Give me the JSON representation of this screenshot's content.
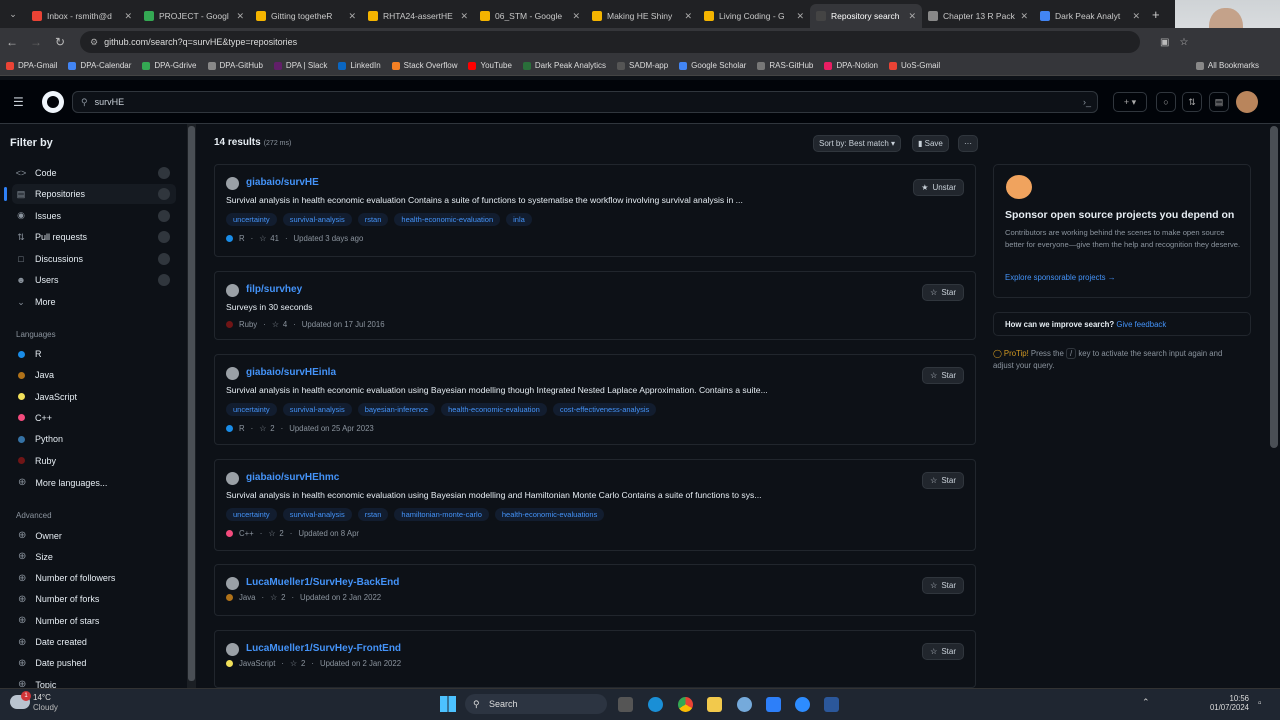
{
  "browser": {
    "tabs": [
      {
        "label": "Inbox - rsmith@d",
        "color": "#ea4335"
      },
      {
        "label": "PROJECT - Googl",
        "color": "#34a853"
      },
      {
        "label": "Gitting togetheR",
        "color": "#f4b400"
      },
      {
        "label": "RHTA24-assertHE",
        "color": "#f4b400"
      },
      {
        "label": "06_STM - Google",
        "color": "#f4b400"
      },
      {
        "label": "Making HE Shiny",
        "color": "#f4b400"
      },
      {
        "label": "Living Coding - G",
        "color": "#f4b400"
      },
      {
        "label": "Repository search",
        "color": "#444444"
      },
      {
        "label": "Chapter 13 R Pack",
        "color": "#888888"
      },
      {
        "label": "Dark Peak Analyt",
        "color": "#4285f4"
      }
    ],
    "url": "github.com/search?q=survHE&type=repositories",
    "bookmarks": [
      "DPA-Gmail",
      "DPA-Calendar",
      "DPA-Gdrive",
      "DPA-GitHub",
      "DPA | Slack",
      "LinkedIn",
      "Stack Overflow",
      "YouTube",
      "Dark Peak Analytics",
      "SADM-app",
      "Google Scholar",
      "RAS-GitHub",
      "DPA-Notion",
      "UoS-Gmail"
    ],
    "all_bookmarks": "All Bookmarks"
  },
  "github": {
    "search_query": "survHE"
  },
  "sidebar": {
    "title": "Filter by",
    "types": [
      {
        "label": "Code",
        "icon": "code-icon"
      },
      {
        "label": "Repositories",
        "icon": "repo-icon",
        "selected": true
      },
      {
        "label": "Issues",
        "icon": "issue-icon"
      },
      {
        "label": "Pull requests",
        "icon": "pull-request-icon"
      },
      {
        "label": "Discussions",
        "icon": "discussion-icon"
      },
      {
        "label": "Users",
        "icon": "people-icon"
      }
    ],
    "more": "More",
    "languages_label": "Languages",
    "languages": [
      {
        "name": "R",
        "color": "#198ce7"
      },
      {
        "name": "Java",
        "color": "#b07219"
      },
      {
        "name": "JavaScript",
        "color": "#f1e05a"
      },
      {
        "name": "C++",
        "color": "#f34b7d"
      },
      {
        "name": "Python",
        "color": "#3572a5"
      },
      {
        "name": "Ruby",
        "color": "#701516"
      }
    ],
    "more_languages": "More languages...",
    "advanced_label": "Advanced",
    "advanced": [
      "Owner",
      "Size",
      "Number of followers",
      "Number of forks",
      "Number of stars",
      "Date created",
      "Date pushed",
      "Topic"
    ]
  },
  "results": {
    "count": "14 results",
    "time": "(272 ms)",
    "sort": "Sort by: Best match",
    "save": "Save",
    "items": [
      {
        "name": "giabaio/survHE",
        "desc": "Survival analysis in health economic evaluation Contains a suite of functions to systematise the workflow involving survival analysis in ...",
        "topics": [
          "uncertainty",
          "survival-analysis",
          "rstan",
          "health-economic-evaluation",
          "inla"
        ],
        "lang": "R",
        "lang_color": "#198ce7",
        "stars": "41",
        "updated": "Updated 3 days ago",
        "star_label": "Unstar"
      },
      {
        "name": "filp/survhey",
        "desc": "Surveys in 30 seconds",
        "topics": [],
        "lang": "Ruby",
        "lang_color": "#701516",
        "stars": "4",
        "updated": "Updated on 17 Jul 2016",
        "star_label": "Star"
      },
      {
        "name": "giabaio/survHEinla",
        "desc": "Survival analysis in health economic evaluation using Bayesian modelling though Integrated Nested Laplace Approximation. Contains a suite...",
        "topics": [
          "uncertainty",
          "survival-analysis",
          "bayesian-inference",
          "health-economic-evaluation",
          "cost-effectiveness-analysis"
        ],
        "lang": "R",
        "lang_color": "#198ce7",
        "stars": "2",
        "updated": "Updated on 25 Apr 2023",
        "star_label": "Star"
      },
      {
        "name": "giabaio/survHEhmc",
        "desc": "Survival analysis in health economic evaluation using Bayesian modelling and Hamiltonian Monte Carlo Contains a suite of functions to sys...",
        "topics": [
          "uncertainty",
          "survival-analysis",
          "rstan",
          "hamiltonian-monte-carlo",
          "health-economic-evaluations"
        ],
        "lang": "C++",
        "lang_color": "#f34b7d",
        "stars": "2",
        "updated": "Updated on 8 Apr",
        "star_label": "Star"
      },
      {
        "name": "LucaMueller1/SurvHey-BackEnd",
        "desc": "",
        "topics": [],
        "lang": "Java",
        "lang_color": "#b07219",
        "stars": "2",
        "updated": "Updated on 2 Jan 2022",
        "star_label": "Star"
      },
      {
        "name": "LucaMueller1/SurvHey-FrontEnd",
        "desc": "",
        "topics": [],
        "lang": "JavaScript",
        "lang_color": "#f1e05a",
        "stars": "2",
        "updated": "Updated on 2 Jan 2022",
        "star_label": "Star"
      }
    ]
  },
  "sponsor": {
    "title": "Sponsor open source projects you depend on",
    "text": "Contributors are working behind the scenes to make open source better for everyone—give them the help and recognition they deserve.",
    "link": "Explore sponsorable projects →"
  },
  "feedback": {
    "question": "How can we improve search?",
    "link": "Give feedback"
  },
  "protip": {
    "label": "ProTip!",
    "text_a": "Press the",
    "key": "/",
    "text_b": "key to activate the search input again and adjust your query."
  },
  "taskbar": {
    "temp": "14°C",
    "weather": "Cloudy",
    "search": "Search",
    "time": "10:56",
    "date": "01/07/2024",
    "notification_count": "1"
  }
}
